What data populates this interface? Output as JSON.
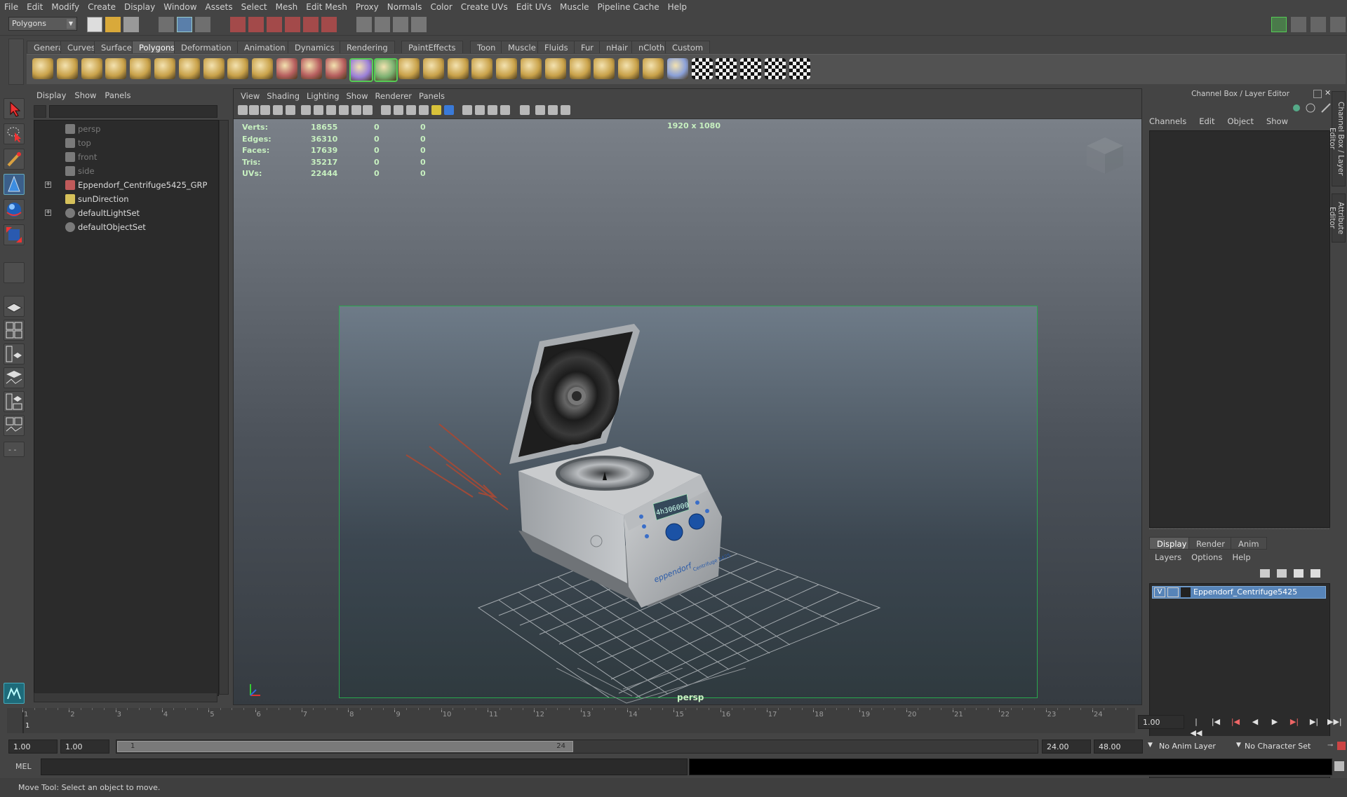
{
  "menubar": [
    "File",
    "Edit",
    "Modify",
    "Create",
    "Display",
    "Window",
    "Assets",
    "Select",
    "Mesh",
    "Edit Mesh",
    "Proxy",
    "Normals",
    "Color",
    "Create UVs",
    "Edit UVs",
    "Muscle",
    "Pipeline Cache",
    "Help"
  ],
  "statusline": {
    "menuset": "Polygons"
  },
  "shelf": {
    "tabs": [
      "General",
      "Curves",
      "Surfaces",
      "Polygons",
      "Deformation",
      "Animation",
      "Dynamics",
      "Rendering",
      "PaintEffects",
      "Toon",
      "Muscle",
      "Fluids",
      "Fur",
      "nHair",
      "nCloth",
      "Custom"
    ],
    "active_tab": "Polygons",
    "icons": [
      "poly-sphere-icon",
      "poly-cube-icon",
      "poly-cylinder-icon",
      "poly-cone-icon",
      "poly-plane-icon",
      "poly-torus-icon",
      "poly-prism-icon",
      "poly-pipe-icon",
      "poly-helix-icon",
      "poly-soccer-icon",
      "combine-icon",
      "separate-icon",
      "extract-icon",
      "smooth-icon",
      "average-vertices-icon",
      "bridge-icon",
      "extrude-icon",
      "append-polygon-icon",
      "split-polygon-icon",
      "insert-edgeloop-icon",
      "offset-edgeloop-icon",
      "cut-faces-icon",
      "merge-vertices-icon",
      "collapse-icon",
      "wedge-icon",
      "poke-icon",
      "sculpt-icon",
      "checker-uv-icon",
      "uv-editor-icon",
      "layout-uv-icon",
      "smart-uv-icon",
      "texture-view-icon"
    ]
  },
  "outliner": {
    "menu": [
      "Display",
      "Show",
      "Panels"
    ],
    "items": [
      {
        "label": "persp",
        "dim": true,
        "expand": false,
        "icon": "camera-icon"
      },
      {
        "label": "top",
        "dim": true,
        "expand": false,
        "icon": "camera-icon"
      },
      {
        "label": "front",
        "dim": true,
        "expand": false,
        "icon": "camera-icon"
      },
      {
        "label": "side",
        "dim": true,
        "expand": false,
        "icon": "camera-icon"
      },
      {
        "label": "Eppendorf_Centrifuge5425_GRP",
        "dim": false,
        "expand": true,
        "icon": "group-transform-icon"
      },
      {
        "label": "sunDirection",
        "dim": false,
        "expand": false,
        "icon": "directional-light-icon"
      },
      {
        "label": "defaultLightSet",
        "dim": false,
        "expand": true,
        "icon": "set-icon"
      },
      {
        "label": "defaultObjectSet",
        "dim": false,
        "expand": false,
        "icon": "set-icon"
      }
    ]
  },
  "viewport": {
    "menu": [
      "View",
      "Shading",
      "Lighting",
      "Show",
      "Renderer",
      "Panels"
    ],
    "hud": [
      {
        "label": "Verts:",
        "value": "18655",
        "sel": "0",
        "comp": "0"
      },
      {
        "label": "Edges:",
        "value": "36310",
        "sel": "0",
        "comp": "0"
      },
      {
        "label": "Faces:",
        "value": "17639",
        "sel": "0",
        "comp": "0"
      },
      {
        "label": "Tris:",
        "value": "35217",
        "sel": "0",
        "comp": "0"
      },
      {
        "label": "UVs:",
        "value": "22444",
        "sel": "0",
        "comp": "0"
      }
    ],
    "resolution": "1920 x 1080",
    "camera": "persp",
    "model_logo": "eppendorf",
    "model_name": "Centrifuge 5425",
    "model_display_left": "4h30",
    "model_display_right": "6000"
  },
  "channelbox": {
    "title": "Channel Box / Layer Editor",
    "menu": [
      "Channels",
      "Edit",
      "Object",
      "Show"
    ],
    "layer_tabs": [
      "Display",
      "Render",
      "Anim"
    ],
    "active_layer_tab": "Display",
    "layer_menu": [
      "Layers",
      "Options",
      "Help"
    ],
    "layer_visibility": "V",
    "layer_name": "Eppendorf_Centrifuge5425",
    "side_tabs": [
      "Channel Box / Layer Editor",
      "Attribute Editor"
    ]
  },
  "timeline": {
    "ticks": [
      "1",
      "2",
      "3",
      "4",
      "5",
      "6",
      "7",
      "8",
      "9",
      "10",
      "11",
      "12",
      "13",
      "14",
      "15",
      "16",
      "17",
      "18",
      "19",
      "20",
      "21",
      "22",
      "23",
      "24"
    ],
    "current_frame": "1",
    "current_time_field": "1.00"
  },
  "range": {
    "start": "1.00",
    "playback_start": "1.00",
    "thumb_start": "1",
    "thumb_end": "24",
    "playback_end": "24.00",
    "end": "48.00",
    "anim_layer": "No Anim Layer",
    "character_set": "No Character Set"
  },
  "command": {
    "label": "MEL"
  },
  "helpline": "Move Tool: Select an object to move.",
  "colors": {
    "hud_text": "#c7f0c0",
    "gate": "#29a84e",
    "layer_highlight": "#5784b8"
  }
}
